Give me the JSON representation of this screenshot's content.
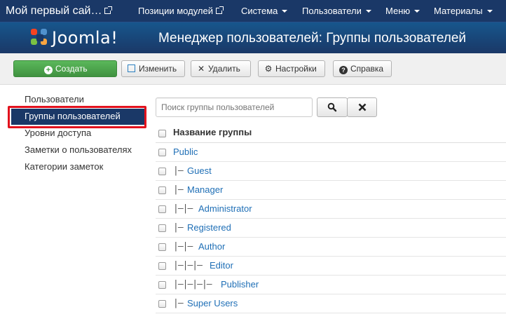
{
  "navbar": {
    "site_name": "Мой первый сай…",
    "items": [
      {
        "label": "Позиции модулей"
      },
      {
        "label": "Система"
      },
      {
        "label": "Пользователи"
      },
      {
        "label": "Меню"
      },
      {
        "label": "Материалы"
      }
    ]
  },
  "header": {
    "logo_text": "Joomla!",
    "title": "Менеджер пользователей: Группы пользователей"
  },
  "toolbar": {
    "create_label": "Создать",
    "edit_label": "Изменить",
    "delete_label": "Удалить",
    "settings_label": "Настройки",
    "help_label": "Справка"
  },
  "sidebar": {
    "items": [
      {
        "label": "Пользователи"
      },
      {
        "label": "Группы пользователей"
      },
      {
        "label": "Уровни доступа"
      },
      {
        "label": "Заметки о пользователях"
      },
      {
        "label": "Категории заметок"
      }
    ]
  },
  "search": {
    "placeholder": "Поиск группы пользователей"
  },
  "table": {
    "header": "Название группы",
    "rows": [
      {
        "prefix": "",
        "name": "Public"
      },
      {
        "prefix": "|—",
        "name": "Guest"
      },
      {
        "prefix": "|—",
        "name": "Manager"
      },
      {
        "prefix": "|—|—",
        "name": "Administrator"
      },
      {
        "prefix": "|—",
        "name": "Registered"
      },
      {
        "prefix": "|—|—",
        "name": "Author"
      },
      {
        "prefix": "|—|—|—",
        "name": "Editor"
      },
      {
        "prefix": "|—|—|—|—",
        "name": "Publisher"
      },
      {
        "prefix": "|—",
        "name": "Super Users"
      }
    ]
  },
  "colors": {
    "navbar": "#1a3867",
    "accent_link": "#1f6fb6",
    "create_button": "#46a546",
    "highlight": "#e2121d"
  }
}
